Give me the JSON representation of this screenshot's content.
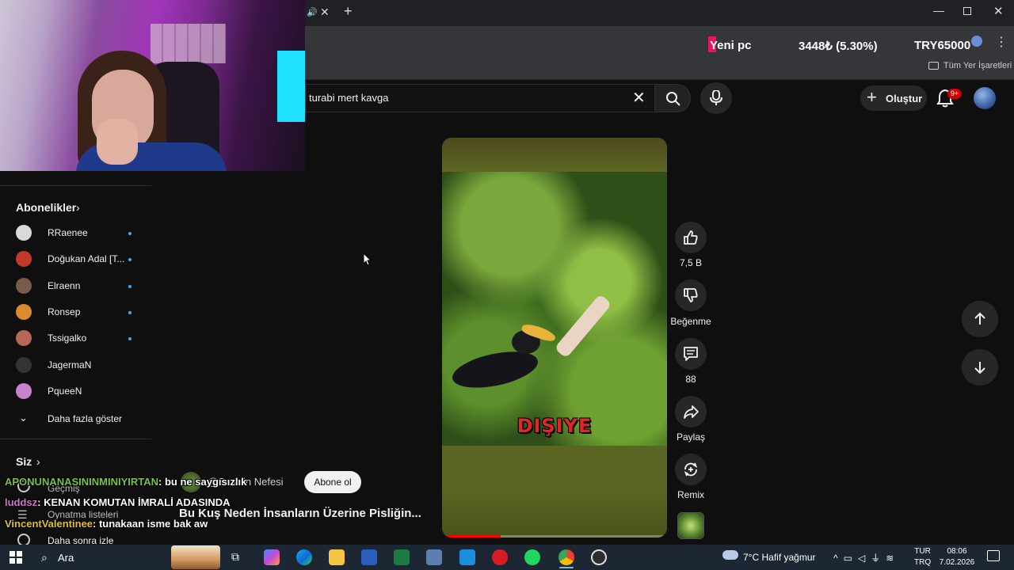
{
  "browser": {
    "ticker": {
      "name": "Yeni pc",
      "change": "3448₺ (5.30%)",
      "goal": "TRY65000"
    },
    "bookmarks_label": "Tüm Yer İşaretleri"
  },
  "header": {
    "search_query": "turabi mert kavga",
    "create_label": "Oluştur",
    "notification_count": "9+"
  },
  "sidebar": {
    "subscriptions_title": "Abonelikler",
    "subscriptions": [
      {
        "name": "RRaenee",
        "color": "#d9d9d9"
      },
      {
        "name": "Doğukan Adal [T...",
        "color": "#c0392b"
      },
      {
        "name": "Elraenn",
        "color": "#7a5a48"
      },
      {
        "name": "Ronsep",
        "color": "#d98c2b"
      },
      {
        "name": "Tssigalko",
        "color": "#b5685a"
      },
      {
        "name": "JagermaN",
        "color": "#333333"
      },
      {
        "name": "PqueeN",
        "color": "#c783c9"
      }
    ],
    "show_more": "Daha fazla göster",
    "you_title": "Siz",
    "you_items": [
      "Geçmiş",
      "Oynatma listeleri",
      "Daha sonra izle"
    ]
  },
  "short": {
    "caption": "DIŞIYE",
    "progress": 0.26,
    "channel_name": "@Sesizin Nefesi",
    "subscribe_label": "Abone ol",
    "title": "Bu Kuş Neden İnsanların Üzerine Pisliğin..."
  },
  "actions": {
    "likes": "7,5 B",
    "dislike": "Beğenme",
    "comments": "88",
    "share": "Paylaş",
    "remix": "Remix"
  },
  "chat": [
    {
      "user": "APONUNANASININMINIYIRTAN",
      "message": ": bu ne saygısızlık",
      "color": "#7cc24a"
    },
    {
      "user": "luddsz",
      "message": ": KENAN KOMUTAN İMRALİ ADASINDA",
      "color": "#d276c8"
    },
    {
      "user": "VincentValentinee",
      "message": ": tunakaan isme bak aw",
      "color": "#e2c12b"
    }
  ],
  "taskbar": {
    "search_label": "Ara",
    "weather": "7°C  Hafif yağmur",
    "lang_top": "TUR",
    "lang_bottom": "TRQ",
    "time": "08:06",
    "date": "7.02.2026"
  }
}
